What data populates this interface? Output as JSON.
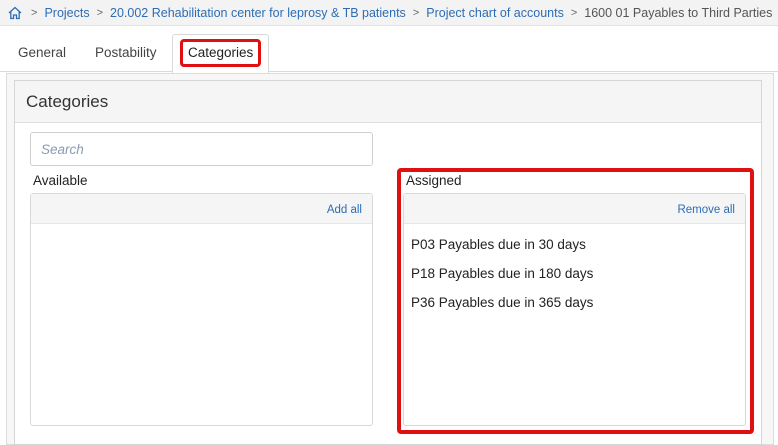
{
  "breadcrumb": {
    "items": [
      {
        "label": "Projects"
      },
      {
        "label": "20.002 Rehabilitation center for leprosy & TB patients"
      },
      {
        "label": "Project chart of accounts"
      }
    ],
    "current": "1600 01 Payables to Third Parties",
    "separator": ">"
  },
  "tabs": [
    {
      "label": "General"
    },
    {
      "label": "Postability"
    },
    {
      "label": "Categories",
      "active": true
    }
  ],
  "panel": {
    "title": "Categories"
  },
  "search": {
    "placeholder": "Search",
    "value": ""
  },
  "available": {
    "label": "Available",
    "action": "Add all",
    "items": []
  },
  "assigned": {
    "label": "Assigned",
    "action": "Remove all",
    "items": [
      {
        "label": "P03 Payables due in 30 days"
      },
      {
        "label": "P18 Payables due in 180 days"
      },
      {
        "label": "P36 Payables due in 365 days"
      }
    ]
  },
  "colors": {
    "link": "#2d6db5",
    "highlight": "#e01010"
  },
  "icons": {
    "home": "home-icon"
  }
}
